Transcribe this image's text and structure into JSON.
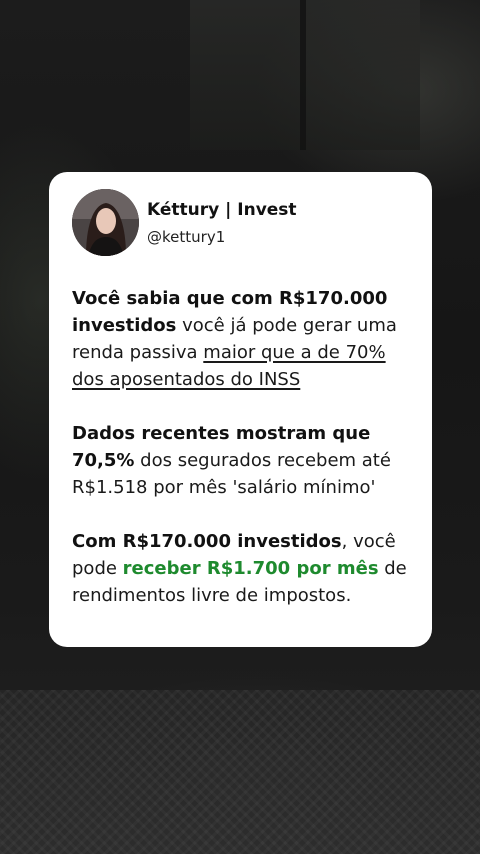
{
  "profile": {
    "name": "Kéttury | Invest",
    "handle": "@kettury1"
  },
  "post": {
    "p1": {
      "s1": "Você sabia que com R$170.000 investidos",
      "s2": " você já pode gerar uma renda passiva ",
      "s3": "maior que a de 70% dos aposentados do INSS"
    },
    "p2": {
      "s1": "Dados recentes mostram que 70,5%",
      "s2": " dos segurados recebem até R$1.518 por mês 'salário mínimo'"
    },
    "p3": {
      "s1": "Com R$170.000 investidos",
      "s2": ", você pode ",
      "s3": "receber R$1.700 por mês",
      "s4": " de rendimentos livre de impostos."
    }
  },
  "colors": {
    "card_background": "#ffffff",
    "highlight_green": "#1e8a2e",
    "text": "#1a1a1a"
  }
}
